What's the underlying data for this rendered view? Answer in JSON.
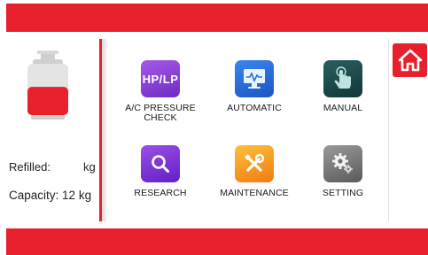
{
  "colors": {
    "accent": "#e8202c",
    "hp_lp_icon": "#8a3fd9",
    "automatic_icon": "#2b6fd8",
    "manual_icon": "#1c4a4a",
    "research_icon": "#7a2fd0",
    "maintenance_icon": "#f39a1c",
    "setting_icon": "#6f6f6f"
  },
  "status": {
    "refilled_label": "Refilled:",
    "refilled_unit": "kg",
    "capacity_label": "Capacity:",
    "capacity_value": "12 kg"
  },
  "tank": {
    "icon": "gas-tank-icon",
    "fill_fraction": 0.55
  },
  "home_button": {
    "icon": "home-icon"
  },
  "menu": [
    {
      "id": "ac-pressure-check",
      "icon": "hp-lp-icon",
      "icon_text": "HP/LP",
      "label_line1": "A/C PRESSURE",
      "label_line2": "CHECK"
    },
    {
      "id": "automatic",
      "icon": "monitor-icon",
      "label_line1": "AUTOMATIC"
    },
    {
      "id": "manual",
      "icon": "hand-touch-icon",
      "label_line1": "MANUAL"
    },
    {
      "id": "research",
      "icon": "search-icon",
      "label_line1": "RESEARCH"
    },
    {
      "id": "maintenance",
      "icon": "tools-icon",
      "label_line1": "MAINTENANCE"
    },
    {
      "id": "setting",
      "icon": "gear-icon",
      "label_line1": "SETTING"
    }
  ]
}
